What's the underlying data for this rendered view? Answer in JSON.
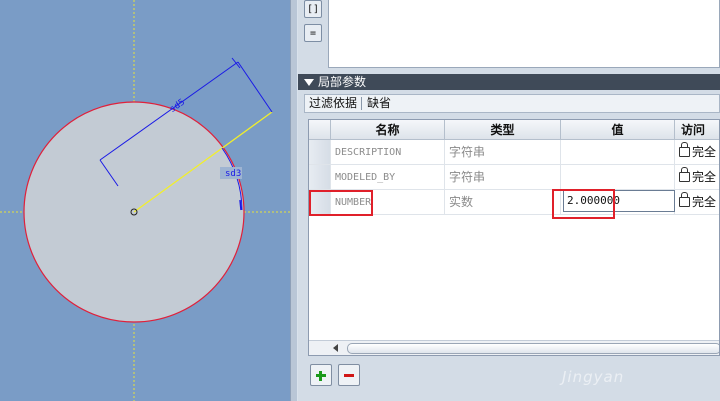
{
  "panel": {
    "side_buttons": [
      "[]",
      "="
    ],
    "section_title": "局部参数",
    "filter_label": "过滤依据",
    "filter_value": "缺省",
    "columns": [
      "名称",
      "类型",
      "值",
      "访问"
    ],
    "rows": [
      {
        "name": "DESCRIPTION",
        "type": "字符串",
        "value": "",
        "access": "完全"
      },
      {
        "name": "MODELED_BY",
        "type": "字符串",
        "value": "",
        "access": "完全"
      },
      {
        "name": "NUMBER",
        "type": "实数",
        "value": "2.000000",
        "access": "完全"
      }
    ],
    "add_button_icon": "plus-icon",
    "remove_button_icon": "minus-icon"
  },
  "viewport": {
    "dim_labels": [
      "sd5",
      "sd3"
    ],
    "circle_edge_color": "#e0203a",
    "background_color": "#7a9cc6",
    "highlight_color": "#e0202a"
  },
  "watermark": "Jingyan"
}
